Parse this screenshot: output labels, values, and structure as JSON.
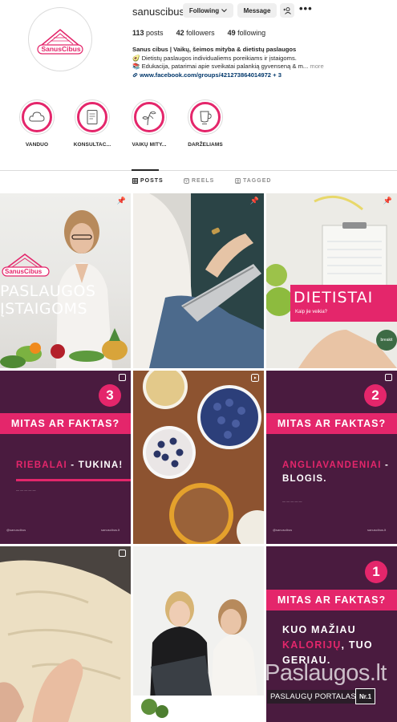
{
  "profile": {
    "username": "sanuscibus",
    "following_label": "Following",
    "message_label": "Message",
    "avatar_text": "SanusCibus",
    "stats": {
      "posts": "113",
      "posts_label": "posts",
      "followers": "42",
      "followers_label": "followers",
      "following": "49",
      "following_label": "following"
    },
    "bio": {
      "name": "Sanus cibus | Vaikų, šeimos mityba & dietistų paslaugos",
      "line1": "🥑 Dietistų paslaugos individualiems poreikiams ir įstaigoms.",
      "line2": "📚 Edukacija, patarimai apie sveikatai palankią gyvenseną & m...",
      "more": "more",
      "link": "www.facebook.com/groups/421273864014972 + 3"
    }
  },
  "highlights": [
    {
      "label": "VANDUO",
      "icon": "cloud-icon"
    },
    {
      "label": "KONSULTAC...",
      "icon": "document-icon"
    },
    {
      "label": "VAIKŲ MITY...",
      "icon": "plant-icon"
    },
    {
      "label": "DARŽELIAMS",
      "icon": "cup-icon"
    }
  ],
  "tabs": {
    "posts": "POSTS",
    "reels": "REELS",
    "tagged": "TAGGED"
  },
  "posts": {
    "p1": {
      "logo": "SanusCibus",
      "title_line1": "PASLAUGOS",
      "title_line2": "ĮSTAIGOMS"
    },
    "p3": {
      "title": "DIETISTAI",
      "subtitle": "Kaip jie veikia?",
      "brand": "breakit"
    },
    "p4": {
      "number": "3",
      "bar": "MITAS AR FAKTAS?",
      "highlight": "RIEBALAI",
      "rest": " - TUKINA!",
      "footer_left": "@sanuscibus",
      "footer_right": "sanuscibus.lt"
    },
    "p6": {
      "number": "2",
      "bar": "MITAS AR FAKTAS?",
      "highlight": "ANGLIAVANDENIAI",
      "rest": " -",
      "line2": "BLOGIS.",
      "footer_left": "@sanuscibus",
      "footer_right": "sanuscibus.lt"
    },
    "p9": {
      "number": "1",
      "bar": "MITAS AR FAKTAS?",
      "line1": "KUO MAŽIAU",
      "highlight": "KALORIJŲ",
      "rest": ", TUO",
      "line3": "GERIAU."
    }
  },
  "watermark": {
    "site": "Paslaugos.lt",
    "portal": "PASLAUGŲ PORTALAS",
    "badge": "Nr.1"
  },
  "colors": {
    "brand_pink": "#e4266b",
    "brand_purple": "#4a1b3f",
    "link_blue": "#00376b"
  }
}
